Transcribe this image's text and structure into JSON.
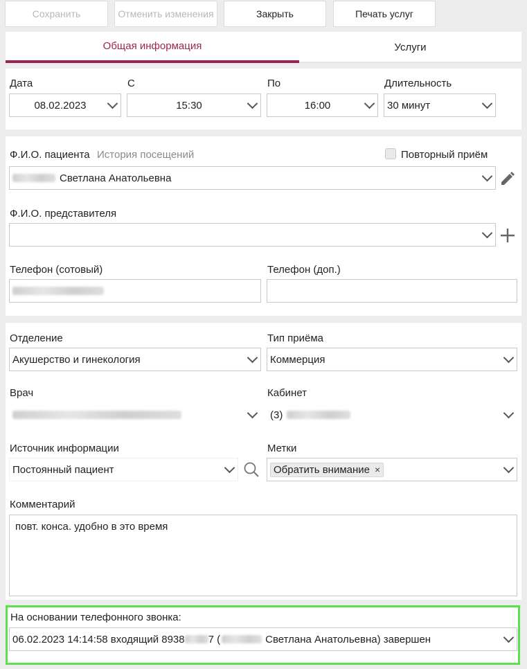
{
  "toolbar": {
    "save_label": "Сохранить",
    "cancel_label": "Отменить изменения",
    "close_label": "Закрыть",
    "print_label": "Печать услуг"
  },
  "tabs": [
    {
      "label": "Общая информация",
      "active": true
    },
    {
      "label": "Услуги",
      "active": false
    }
  ],
  "schedule": {
    "date_label": "Дата",
    "date_value": "08.02.2023",
    "from_label": "С",
    "from_value": "15:30",
    "to_label": "По",
    "to_value": "16:00",
    "duration_label": "Длительность",
    "duration_value": "30 минут"
  },
  "patient": {
    "label": "Ф.И.О. пациента",
    "history_link": "История посещений",
    "repeat_label": "Повторный приём",
    "repeat_checked": false,
    "name_visible": "Светлана Анатольевна",
    "rep_label": "Ф.И.О. представителя",
    "rep_value": "",
    "phone_mobile_label": "Телефон (сотовый)",
    "phone_extra_label": "Телефон (доп.)",
    "phone_extra_value": ""
  },
  "visit": {
    "department_label": "Отделение",
    "department_value": "Акушерство и гинекология",
    "type_label": "Тип приёма",
    "type_value": "Коммерция",
    "doctor_label": "Врач",
    "room_label": "Кабинет",
    "room_prefix": "(3)",
    "source_label": "Источник информации",
    "source_value": "Постоянный пациент",
    "tags_label": "Метки",
    "tag_value": "Обратить внимание",
    "tag_remove": "×",
    "comment_label": "Комментарий",
    "comment_value": "повт. конса. удобно в это время"
  },
  "call": {
    "label": "На основании телефонного звонка:",
    "value_part1": "06.02.2023 14:14:58 входящий 8938",
    "value_part2": "7 (",
    "value_part3": "Светлана Анатольевна) завершен"
  },
  "colors": {
    "accent": "#9b2454",
    "highlight": "#5de04f"
  }
}
